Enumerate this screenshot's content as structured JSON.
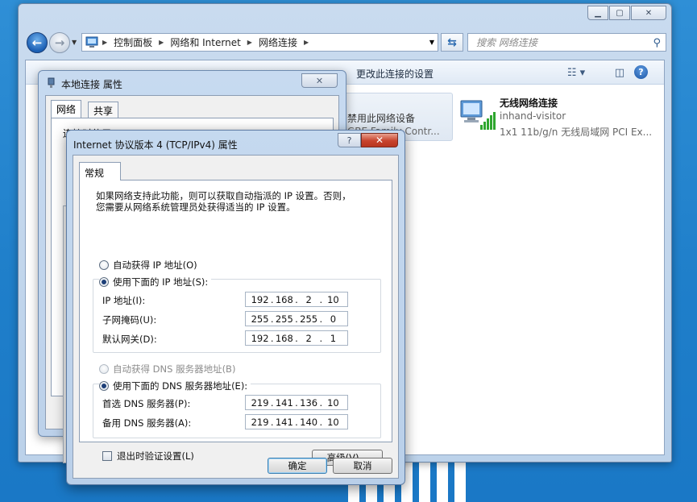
{
  "explorer": {
    "breadcrumbs": [
      "控制面板",
      "网络和 Internet",
      "网络连接"
    ],
    "search_placeholder": "搜索 网络连接",
    "cmdbar": {
      "change_settings": "更改此连接的设置"
    },
    "tiles": {
      "partial_line1": "禁用此网络设备",
      "partial_line2": "GBE Family Contr...",
      "wireless": {
        "name": "无线网络连接",
        "ssid": "inhand-visitor",
        "device": "1x1 11b/g/n 无线局域网 PCI Ex..."
      }
    }
  },
  "lan_dialog": {
    "title": "本地连接 属性",
    "tabs": [
      "网络",
      "共享"
    ],
    "connect_using_label": "连接时使用:"
  },
  "ipv4_dialog": {
    "title": "Internet 协议版本 4 (TCP/IPv4) 属性",
    "tab": "常规",
    "description_line1": "如果网络支持此功能，则可以获取自动指派的 IP 设置。否则，",
    "description_line2": "您需要从网络系统管理员处获得适当的 IP 设置。",
    "auto_ip_label": "自动获得 IP 地址(O)",
    "manual_ip_label": "使用下面的 IP 地址(S):",
    "ip_label": "IP 地址(I):",
    "ip": [
      "192",
      "168",
      "2",
      "10"
    ],
    "mask_label": "子网掩码(U):",
    "mask": [
      "255",
      "255",
      "255",
      "0"
    ],
    "gateway_label": "默认网关(D):",
    "gateway": [
      "192",
      "168",
      "2",
      "1"
    ],
    "auto_dns_label": "自动获得 DNS 服务器地址(B)",
    "manual_dns_label": "使用下面的 DNS 服务器地址(E):",
    "dns1_label": "首选 DNS 服务器(P):",
    "dns1": [
      "219",
      "141",
      "136",
      "10"
    ],
    "dns2_label": "备用 DNS 服务器(A):",
    "dns2": [
      "219",
      "141",
      "140",
      "10"
    ],
    "validate_label": "退出时验证设置(L)",
    "advanced_label": "高级(V)...",
    "ok_label": "确定",
    "cancel_label": "取消"
  }
}
